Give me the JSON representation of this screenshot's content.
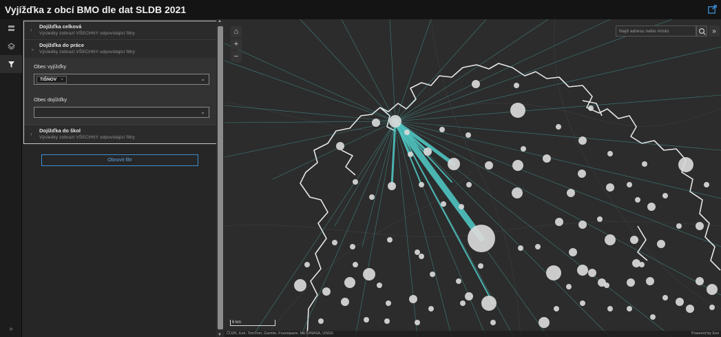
{
  "app": {
    "title": "Vyjížďka z obcí BMO dle dat SLDB 2021"
  },
  "rail": {
    "items": [
      {
        "icon": "layers-list-icon",
        "active": false
      },
      {
        "icon": "basemap-icon",
        "active": false
      },
      {
        "icon": "filter-icon",
        "active": true
      }
    ],
    "expand_label": "»"
  },
  "filters": {
    "sections": [
      {
        "title": "Dojížďka celková",
        "subtitle": "Výsledky zobrazí VŠECHNY odpovídající filtry",
        "expanded": false
      },
      {
        "title": "Dojížďka do práce",
        "subtitle": "Výsledky zobrazí VŠECHNY odpovídající filtry",
        "expanded": true
      },
      {
        "title": "Dojížďka do škol",
        "subtitle": "Výsledky zobrazí VŠECHNY odpovídající filtry",
        "expanded": false
      }
    ],
    "origin_label": "Obec vyjížďky",
    "origin_selected": "TIŠNOV",
    "destination_label": "Obec dojížďky",
    "destination_value": "",
    "refresh_label": "Obnovit filtr"
  },
  "map": {
    "search_placeholder": "Najít adresu nebo místo",
    "scale_label": "6 km",
    "attribution": "ČÚZK, Esri, TomTom, Garmin, Foursquare, METI/NASA, USGS",
    "powered_by": "Powered by Esri",
    "controls": [
      "home-icon",
      "zoom-in-icon",
      "zoom-out-icon"
    ],
    "flow_color": "#4fc3c0",
    "point_color": "#d9d9d9",
    "origin": "TIŠNOV"
  }
}
